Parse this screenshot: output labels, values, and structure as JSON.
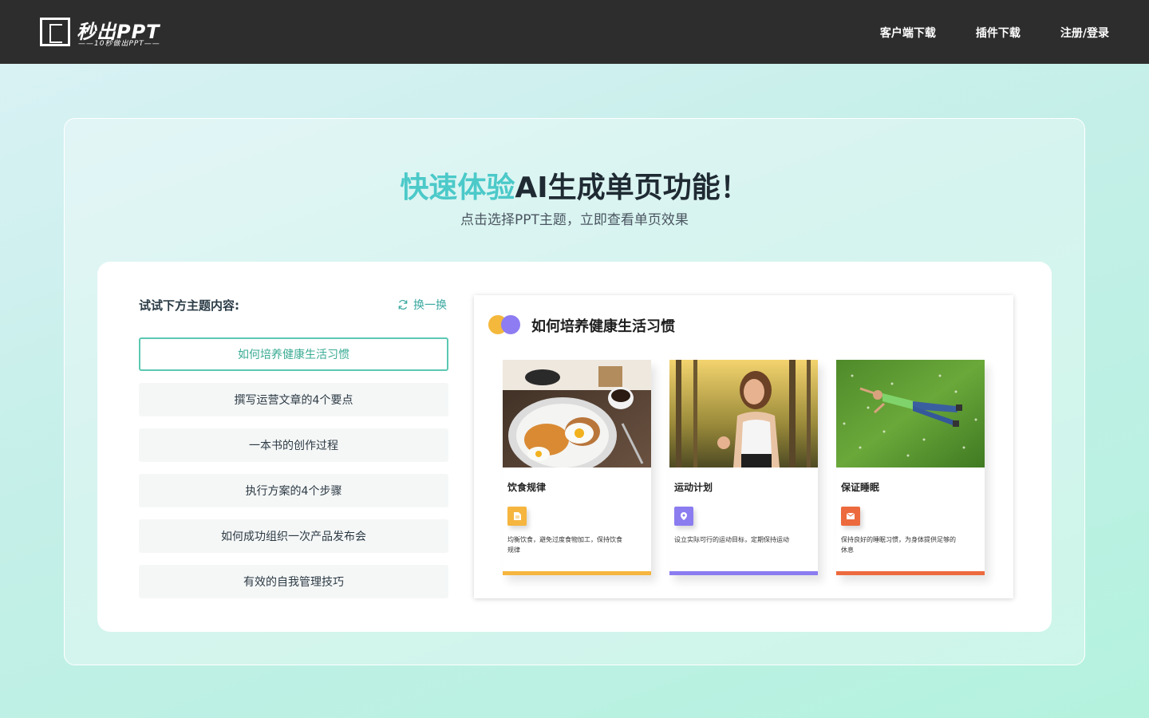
{
  "header": {
    "logo_text": "秒出PPT",
    "logo_tagline": "——10秒做出PPT——",
    "nav": [
      "客户端下载",
      "插件下载",
      "注册/登录"
    ]
  },
  "hero": {
    "title_accent": "快速体验",
    "title_rest": "AI生成单页功能！",
    "subtitle": "点击选择PPT主题，立即查看单页效果"
  },
  "picker": {
    "label": "试试下方主题内容:",
    "refresh_label": "换一换",
    "topics": [
      "如何培养健康生活习惯",
      "撰写运营文章的4个要点",
      "一本书的创作过程",
      "执行方案的4个步骤",
      "如何成功组织一次产品发布会",
      "有效的自我管理技巧"
    ],
    "active_index": 0
  },
  "preview": {
    "title": "如何培养健康生活习惯",
    "cards": [
      {
        "title": "饮食规律",
        "desc": "均衡饮食，避免过度食物加工，保持饮食规律",
        "color": "#f5b53f",
        "icon": "document-icon",
        "photo": "breakfast-photo"
      },
      {
        "title": "运动计划",
        "desc": "设立实际可行的运动目标，定期保持运动",
        "color": "#8b7cf0",
        "icon": "location-pin-icon",
        "photo": "running-woman-photo"
      },
      {
        "title": "保证睡眠",
        "desc": "保持良好的睡眠习惯，为身体提供足够的休息",
        "color": "#ec6a3d",
        "icon": "mail-icon",
        "photo": "lying-on-grass-photo"
      }
    ]
  },
  "colors": {
    "accent": "#4cc9c9",
    "active_border": "#5cc8b2",
    "header_bg": "#2d2d2d"
  }
}
